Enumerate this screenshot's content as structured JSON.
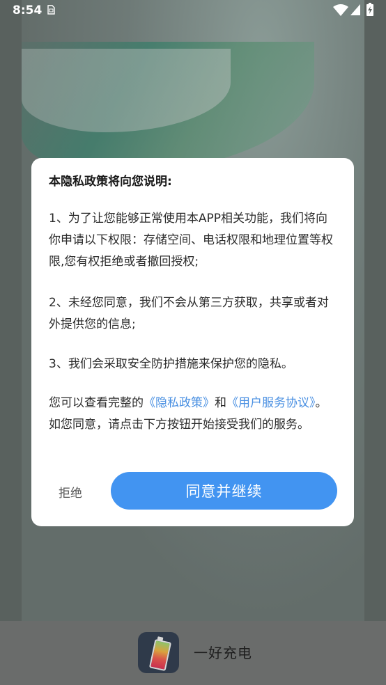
{
  "status_bar": {
    "time": "8:54",
    "sim_icon": "sim-card-icon",
    "wifi_icon": "wifi-icon",
    "signal_icon": "cell-signal-icon",
    "battery_icon": "battery-charging-icon"
  },
  "dialog": {
    "title": "本隐私政策将向您说明:",
    "p1": "1、为了让您能够正常使用本APP相关功能，我们将向你申请以下权限：存储空间、电话权限和地理位置等权限,您有权拒绝或者撤回授权;",
    "p2": "2、未经您同意，我们不会从第三方获取，共享或者对外提供您的信息;",
    "p3": "3、我们会采取安全防护措施来保护您的隐私。",
    "p4_prefix": "您可以查看完整的",
    "privacy_link": "《隐私政策》",
    "p4_and": "和",
    "terms_link": "《用户服务协议》",
    "p4_suffix": "。如您同意，请点击下方按钮开始接受我们的服务。",
    "reject_label": "拒绝",
    "agree_label": "同意并继续"
  },
  "app": {
    "name": "一好充电",
    "icon": "battery-app-icon"
  },
  "colors": {
    "accent": "#4294f1",
    "link": "#4a90e2"
  }
}
